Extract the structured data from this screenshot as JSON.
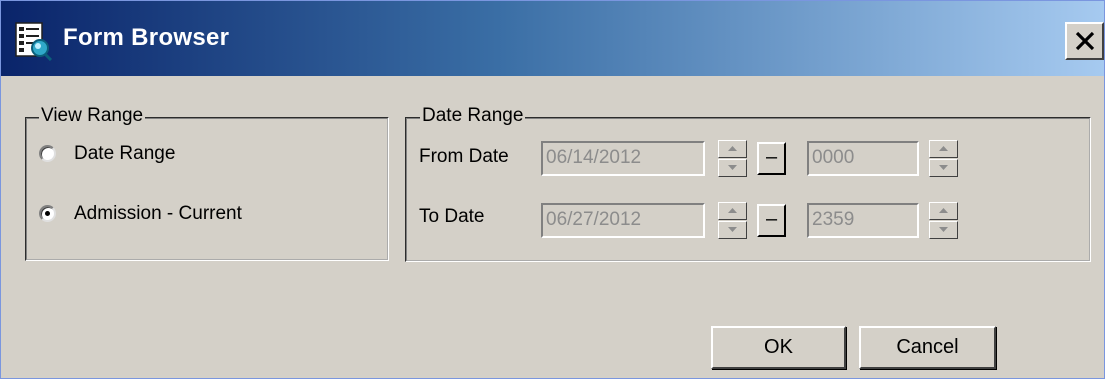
{
  "window": {
    "title": "Form Browser",
    "icon": "form-browser-icon",
    "close_label": "close"
  },
  "view_range": {
    "legend": "View Range",
    "options": [
      {
        "label": "Date Range",
        "selected": false
      },
      {
        "label": "Admission - Current",
        "selected": true
      }
    ]
  },
  "date_range": {
    "legend": "Date Range",
    "from_label": "From Date",
    "to_label": "To Date",
    "from_date": "06/14/2012",
    "from_time": "0000",
    "to_date": "06/27/2012",
    "to_time": "2359",
    "dash_label": "–",
    "disabled": true
  },
  "buttons": {
    "ok": "OK",
    "cancel": "Cancel"
  }
}
